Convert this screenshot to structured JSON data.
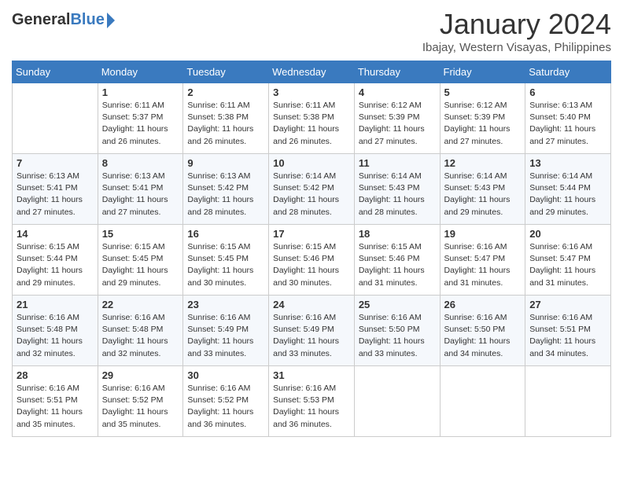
{
  "header": {
    "logo_general": "General",
    "logo_blue": "Blue",
    "month_title": "January 2024",
    "location": "Ibajay, Western Visayas, Philippines"
  },
  "weekdays": [
    "Sunday",
    "Monday",
    "Tuesday",
    "Wednesday",
    "Thursday",
    "Friday",
    "Saturday"
  ],
  "weeks": [
    [
      {
        "day": "",
        "sunrise": "",
        "sunset": "",
        "daylight": ""
      },
      {
        "day": "1",
        "sunrise": "Sunrise: 6:11 AM",
        "sunset": "Sunset: 5:37 PM",
        "daylight": "Daylight: 11 hours and 26 minutes."
      },
      {
        "day": "2",
        "sunrise": "Sunrise: 6:11 AM",
        "sunset": "Sunset: 5:38 PM",
        "daylight": "Daylight: 11 hours and 26 minutes."
      },
      {
        "day": "3",
        "sunrise": "Sunrise: 6:11 AM",
        "sunset": "Sunset: 5:38 PM",
        "daylight": "Daylight: 11 hours and 26 minutes."
      },
      {
        "day": "4",
        "sunrise": "Sunrise: 6:12 AM",
        "sunset": "Sunset: 5:39 PM",
        "daylight": "Daylight: 11 hours and 27 minutes."
      },
      {
        "day": "5",
        "sunrise": "Sunrise: 6:12 AM",
        "sunset": "Sunset: 5:39 PM",
        "daylight": "Daylight: 11 hours and 27 minutes."
      },
      {
        "day": "6",
        "sunrise": "Sunrise: 6:13 AM",
        "sunset": "Sunset: 5:40 PM",
        "daylight": "Daylight: 11 hours and 27 minutes."
      }
    ],
    [
      {
        "day": "7",
        "sunrise": "Sunrise: 6:13 AM",
        "sunset": "Sunset: 5:41 PM",
        "daylight": "Daylight: 11 hours and 27 minutes."
      },
      {
        "day": "8",
        "sunrise": "Sunrise: 6:13 AM",
        "sunset": "Sunset: 5:41 PM",
        "daylight": "Daylight: 11 hours and 27 minutes."
      },
      {
        "day": "9",
        "sunrise": "Sunrise: 6:13 AM",
        "sunset": "Sunset: 5:42 PM",
        "daylight": "Daylight: 11 hours and 28 minutes."
      },
      {
        "day": "10",
        "sunrise": "Sunrise: 6:14 AM",
        "sunset": "Sunset: 5:42 PM",
        "daylight": "Daylight: 11 hours and 28 minutes."
      },
      {
        "day": "11",
        "sunrise": "Sunrise: 6:14 AM",
        "sunset": "Sunset: 5:43 PM",
        "daylight": "Daylight: 11 hours and 28 minutes."
      },
      {
        "day": "12",
        "sunrise": "Sunrise: 6:14 AM",
        "sunset": "Sunset: 5:43 PM",
        "daylight": "Daylight: 11 hours and 29 minutes."
      },
      {
        "day": "13",
        "sunrise": "Sunrise: 6:14 AM",
        "sunset": "Sunset: 5:44 PM",
        "daylight": "Daylight: 11 hours and 29 minutes."
      }
    ],
    [
      {
        "day": "14",
        "sunrise": "Sunrise: 6:15 AM",
        "sunset": "Sunset: 5:44 PM",
        "daylight": "Daylight: 11 hours and 29 minutes."
      },
      {
        "day": "15",
        "sunrise": "Sunrise: 6:15 AM",
        "sunset": "Sunset: 5:45 PM",
        "daylight": "Daylight: 11 hours and 29 minutes."
      },
      {
        "day": "16",
        "sunrise": "Sunrise: 6:15 AM",
        "sunset": "Sunset: 5:45 PM",
        "daylight": "Daylight: 11 hours and 30 minutes."
      },
      {
        "day": "17",
        "sunrise": "Sunrise: 6:15 AM",
        "sunset": "Sunset: 5:46 PM",
        "daylight": "Daylight: 11 hours and 30 minutes."
      },
      {
        "day": "18",
        "sunrise": "Sunrise: 6:15 AM",
        "sunset": "Sunset: 5:46 PM",
        "daylight": "Daylight: 11 hours and 31 minutes."
      },
      {
        "day": "19",
        "sunrise": "Sunrise: 6:16 AM",
        "sunset": "Sunset: 5:47 PM",
        "daylight": "Daylight: 11 hours and 31 minutes."
      },
      {
        "day": "20",
        "sunrise": "Sunrise: 6:16 AM",
        "sunset": "Sunset: 5:47 PM",
        "daylight": "Daylight: 11 hours and 31 minutes."
      }
    ],
    [
      {
        "day": "21",
        "sunrise": "Sunrise: 6:16 AM",
        "sunset": "Sunset: 5:48 PM",
        "daylight": "Daylight: 11 hours and 32 minutes."
      },
      {
        "day": "22",
        "sunrise": "Sunrise: 6:16 AM",
        "sunset": "Sunset: 5:48 PM",
        "daylight": "Daylight: 11 hours and 32 minutes."
      },
      {
        "day": "23",
        "sunrise": "Sunrise: 6:16 AM",
        "sunset": "Sunset: 5:49 PM",
        "daylight": "Daylight: 11 hours and 33 minutes."
      },
      {
        "day": "24",
        "sunrise": "Sunrise: 6:16 AM",
        "sunset": "Sunset: 5:49 PM",
        "daylight": "Daylight: 11 hours and 33 minutes."
      },
      {
        "day": "25",
        "sunrise": "Sunrise: 6:16 AM",
        "sunset": "Sunset: 5:50 PM",
        "daylight": "Daylight: 11 hours and 33 minutes."
      },
      {
        "day": "26",
        "sunrise": "Sunrise: 6:16 AM",
        "sunset": "Sunset: 5:50 PM",
        "daylight": "Daylight: 11 hours and 34 minutes."
      },
      {
        "day": "27",
        "sunrise": "Sunrise: 6:16 AM",
        "sunset": "Sunset: 5:51 PM",
        "daylight": "Daylight: 11 hours and 34 minutes."
      }
    ],
    [
      {
        "day": "28",
        "sunrise": "Sunrise: 6:16 AM",
        "sunset": "Sunset: 5:51 PM",
        "daylight": "Daylight: 11 hours and 35 minutes."
      },
      {
        "day": "29",
        "sunrise": "Sunrise: 6:16 AM",
        "sunset": "Sunset: 5:52 PM",
        "daylight": "Daylight: 11 hours and 35 minutes."
      },
      {
        "day": "30",
        "sunrise": "Sunrise: 6:16 AM",
        "sunset": "Sunset: 5:52 PM",
        "daylight": "Daylight: 11 hours and 36 minutes."
      },
      {
        "day": "31",
        "sunrise": "Sunrise: 6:16 AM",
        "sunset": "Sunset: 5:53 PM",
        "daylight": "Daylight: 11 hours and 36 minutes."
      },
      {
        "day": "",
        "sunrise": "",
        "sunset": "",
        "daylight": ""
      },
      {
        "day": "",
        "sunrise": "",
        "sunset": "",
        "daylight": ""
      },
      {
        "day": "",
        "sunrise": "",
        "sunset": "",
        "daylight": ""
      }
    ]
  ]
}
